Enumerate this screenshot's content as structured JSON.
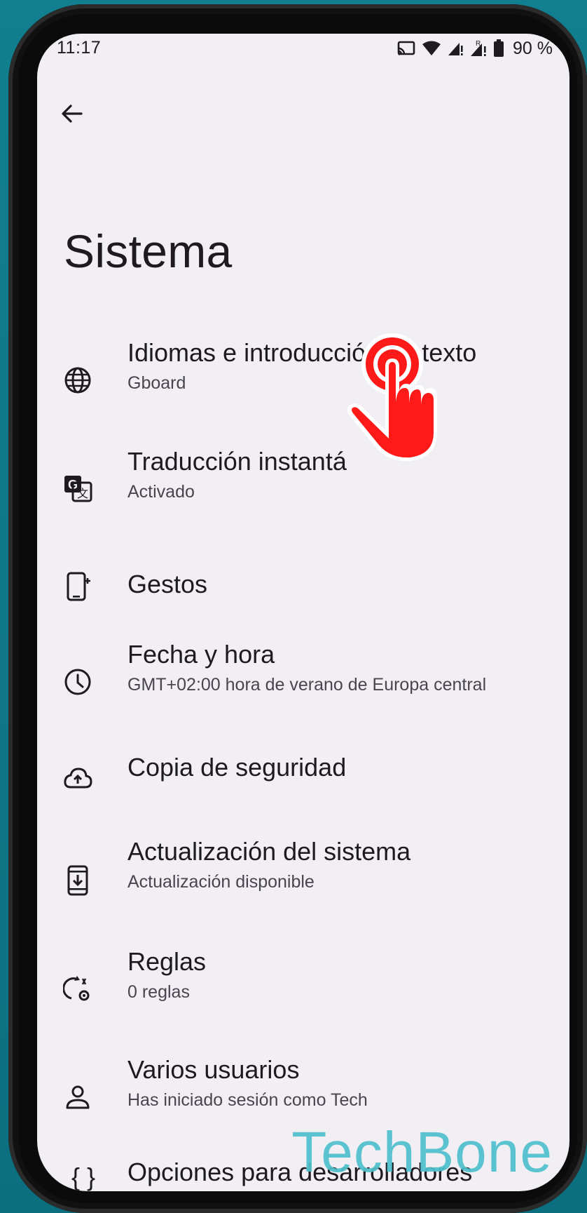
{
  "status_bar": {
    "time": "11:17",
    "battery_percent": "90 %",
    "icons": [
      "cast-icon",
      "wifi-icon",
      "signal-icon-1",
      "signal-roaming-icon-2",
      "battery-icon"
    ]
  },
  "header": {
    "back_icon": "arrow-back-icon",
    "title": "Sistema"
  },
  "items": [
    {
      "icon": "globe-icon",
      "title": "Idiomas e introducción de texto",
      "subtitle": "Gboard"
    },
    {
      "icon": "translate-icon",
      "title": "Traducción instantá",
      "subtitle": "Activado"
    },
    {
      "icon": "phone-gesture-icon",
      "title": "Gestos",
      "subtitle": ""
    },
    {
      "icon": "clock-icon",
      "title": "Fecha y hora",
      "subtitle": "GMT+02:00 hora de verano de Europa central"
    },
    {
      "icon": "cloud-upload-icon",
      "title": "Copia de seguridad",
      "subtitle": ""
    },
    {
      "icon": "system-update-icon",
      "title": "Actualización del sistema",
      "subtitle": "Actualización disponible"
    },
    {
      "icon": "rules-icon",
      "title": "Reglas",
      "subtitle": "0 reglas"
    },
    {
      "icon": "person-icon",
      "title": "Varios usuarios",
      "subtitle": "Has iniciado sesión como Tech"
    },
    {
      "icon": "braces-icon",
      "title": "Opciones para desarrolladores",
      "subtitle": ""
    }
  ],
  "overlay": {
    "touch_icon": "tap-hand-icon",
    "watermark": "TechBone"
  },
  "colors": {
    "background": "#0f7a8a",
    "screen": "#f1eff4",
    "text_primary": "#1d1b20",
    "text_secondary": "#49454f",
    "tap_red": "#ff1a1a",
    "watermark": "#4fc0cc"
  }
}
